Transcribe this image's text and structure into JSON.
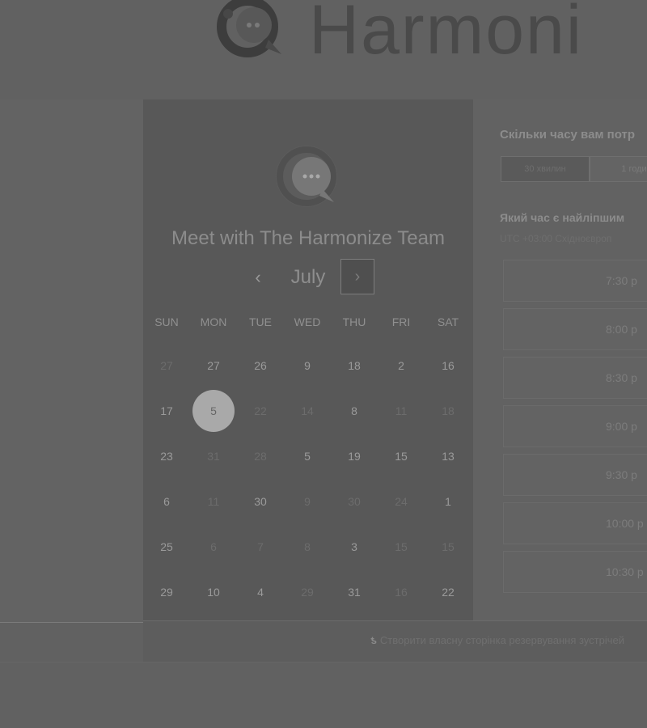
{
  "brand": {
    "name": "Harmoni",
    "logo_icon": "chat-bubble-logo-icon"
  },
  "calendar": {
    "title": "Meet with The Harmonize Team",
    "month": "July",
    "prev_label": "‹",
    "next_label": "›",
    "weekdays": [
      "SUN",
      "MON",
      "TUE",
      "WED",
      "THU",
      "FRI",
      "SAT"
    ],
    "selected_day": "5",
    "weeks": [
      [
        {
          "d": "27",
          "faded": true
        },
        {
          "d": "27",
          "faded": false
        },
        {
          "d": "26",
          "faded": false
        },
        {
          "d": "9",
          "faded": false
        },
        {
          "d": "18",
          "faded": false
        },
        {
          "d": "2",
          "faded": false
        },
        {
          "d": "16",
          "faded": false
        }
      ],
      [
        {
          "d": "17",
          "faded": false
        },
        {
          "d": "5",
          "faded": false,
          "selected": true
        },
        {
          "d": "22",
          "faded": true
        },
        {
          "d": "14",
          "faded": true
        },
        {
          "d": "8",
          "faded": false
        },
        {
          "d": "11",
          "faded": true
        },
        {
          "d": "18",
          "faded": true
        }
      ],
      [
        {
          "d": "23",
          "faded": false
        },
        {
          "d": "31",
          "faded": true
        },
        {
          "d": "28",
          "faded": true
        },
        {
          "d": "5",
          "faded": false
        },
        {
          "d": "19",
          "faded": false
        },
        {
          "d": "15",
          "faded": false
        },
        {
          "d": "13",
          "faded": false
        }
      ],
      [
        {
          "d": "6",
          "faded": false
        },
        {
          "d": "11",
          "faded": true
        },
        {
          "d": "30",
          "faded": false
        },
        {
          "d": "9",
          "faded": true
        },
        {
          "d": "30",
          "faded": true
        },
        {
          "d": "24",
          "faded": true
        },
        {
          "d": "1",
          "faded": false
        }
      ],
      [
        {
          "d": "25",
          "faded": false
        },
        {
          "d": "6",
          "faded": true
        },
        {
          "d": "7",
          "faded": true
        },
        {
          "d": "8",
          "faded": true
        },
        {
          "d": "3",
          "faded": false
        },
        {
          "d": "15",
          "faded": true
        },
        {
          "d": "15",
          "faded": true
        }
      ],
      [
        {
          "d": "29",
          "faded": false
        },
        {
          "d": "10",
          "faded": false
        },
        {
          "d": "4",
          "faded": false
        },
        {
          "d": "29",
          "faded": true
        },
        {
          "d": "31",
          "faded": false
        },
        {
          "d": "16",
          "faded": true
        },
        {
          "d": "22",
          "faded": false
        }
      ]
    ]
  },
  "booking": {
    "duration_question": "Скільки часу вам потр",
    "durations": [
      {
        "label": "30 хвилин",
        "active": true
      },
      {
        "label": "1 годи",
        "active": false
      }
    ],
    "time_question": "Який час є найліпшим",
    "timezone": "UTC +03:00 Східноєвроп",
    "slots": [
      "7:30 p",
      "8:00 p",
      "8:30 p",
      "9:00 p",
      "9:30 p",
      "10:00 p",
      "10:30 p"
    ]
  },
  "footer": {
    "link_icon": "harmonize-logo-icon",
    "link_text": "Створити власну сторінка резервування зустрічей"
  }
}
